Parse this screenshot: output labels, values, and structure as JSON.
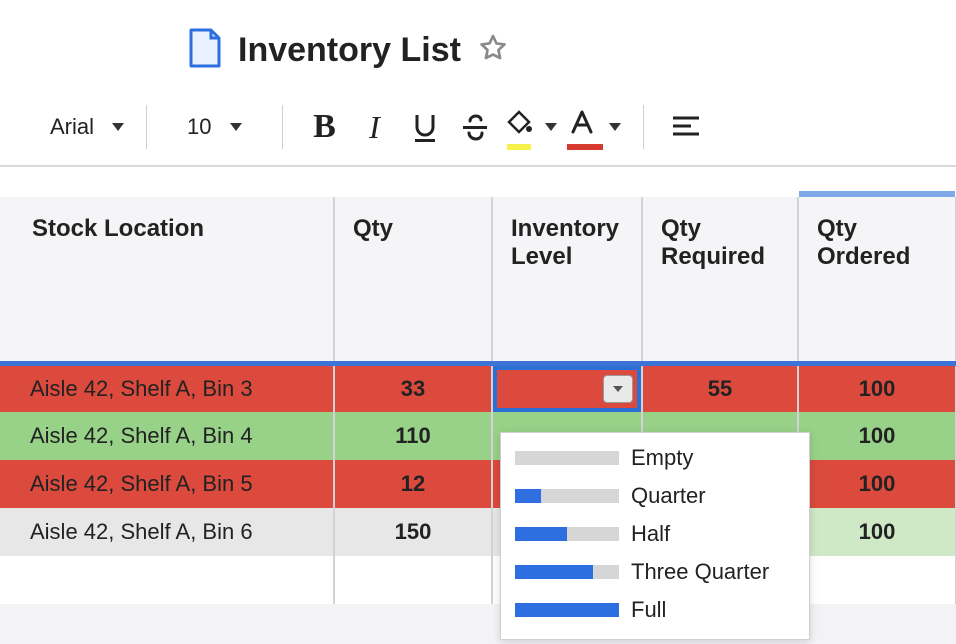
{
  "doc": {
    "title": "Inventory List"
  },
  "toolbar": {
    "font_name": "Arial",
    "font_size": "10"
  },
  "columns": {
    "stock_location": "Stock Location",
    "qty": "Qty",
    "inventory_level": "Inventory Level",
    "qty_required": "Qty Required",
    "qty_ordered": "Qty Ordered"
  },
  "rows": [
    {
      "loc": "Aisle 42, Shelf A, Bin 3",
      "qty": "33",
      "inv": "",
      "req": "55",
      "ord": "100",
      "tone": "red",
      "selected": true
    },
    {
      "loc": "Aisle 42, Shelf A, Bin 4",
      "qty": "110",
      "inv": "",
      "req": "",
      "ord": "100",
      "tone": "green"
    },
    {
      "loc": "Aisle 42, Shelf A, Bin 5",
      "qty": "12",
      "inv": "",
      "req": "",
      "ord": "100",
      "tone": "red"
    },
    {
      "loc": "Aisle 42, Shelf A, Bin 6",
      "qty": "150",
      "inv": "",
      "req": "",
      "ord": "100",
      "tone": "lightgreen"
    }
  ],
  "dropdown": {
    "options": [
      {
        "label": "Empty",
        "fill_pct": 0
      },
      {
        "label": "Quarter",
        "fill_pct": 25
      },
      {
        "label": "Half",
        "fill_pct": 50
      },
      {
        "label": "Three Quarter",
        "fill_pct": 75
      },
      {
        "label": "Full",
        "fill_pct": 100
      }
    ]
  }
}
